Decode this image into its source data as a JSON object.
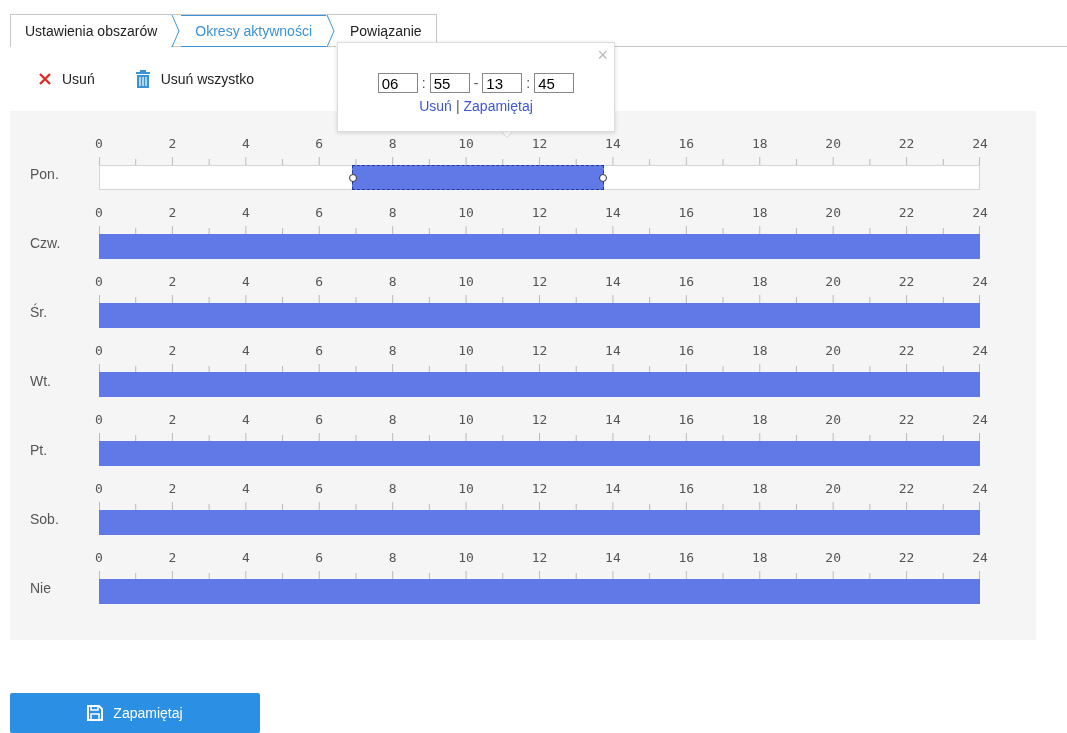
{
  "tabs": [
    {
      "label": "Ustawienia obszarów",
      "selected": false
    },
    {
      "label": "Okresy aktywności",
      "selected": true
    },
    {
      "label": "Powiązanie",
      "selected": false
    }
  ],
  "toolbar": [
    {
      "kind": "delete",
      "label": "Usuń"
    },
    {
      "kind": "delete_all",
      "label": "Usuń wszystko"
    }
  ],
  "days": [
    {
      "label": "Pon.",
      "scale": [
        "0",
        "2",
        "4",
        "6",
        "8",
        "10",
        "12",
        "14",
        "16",
        "18",
        "20",
        "22",
        "24"
      ],
      "filled": false,
      "selected": true
    },
    {
      "label": "Czw.",
      "scale": [
        "0",
        "2",
        "4",
        "6",
        "8",
        "10",
        "12",
        "14",
        "16",
        "18",
        "20",
        "22",
        "24"
      ],
      "filled": true,
      "selected": false
    },
    {
      "label": "Śr.",
      "scale": [
        "0",
        "2",
        "4",
        "6",
        "8",
        "10",
        "12",
        "14",
        "16",
        "18",
        "20",
        "22",
        "24"
      ],
      "filled": true,
      "selected": false
    },
    {
      "label": "Wt.",
      "scale": [
        "0",
        "2",
        "4",
        "6",
        "8",
        "10",
        "12",
        "14",
        "16",
        "18",
        "20",
        "22",
        "24"
      ],
      "filled": true,
      "selected": false
    },
    {
      "label": "Pt.",
      "scale": [
        "0",
        "2",
        "4",
        "6",
        "8",
        "10",
        "12",
        "14",
        "16",
        "18",
        "20",
        "22",
        "24"
      ],
      "filled": true,
      "selected": false
    },
    {
      "label": "Sob.",
      "scale": [
        "0",
        "2",
        "4",
        "6",
        "8",
        "10",
        "12",
        "14",
        "16",
        "18",
        "20",
        "22",
        "24"
      ],
      "filled": true,
      "selected": false
    },
    {
      "label": "Nie",
      "scale": [
        "0",
        "2",
        "4",
        "6",
        "8",
        "10",
        "12",
        "14",
        "16",
        "18",
        "20",
        "22",
        "24"
      ],
      "filled": true,
      "selected": false
    }
  ],
  "popup": {
    "close": "×",
    "start_hour": "06",
    "start_minute": "55",
    "end_hour": "13",
    "end_minute": "45",
    "time_separator": ":",
    "range_separator": "-",
    "delete_link": "Usuń",
    "link_separator": "|",
    "save_link": "Zapamiętaj"
  },
  "save_button": {
    "label": "Zapamiętaj"
  }
}
